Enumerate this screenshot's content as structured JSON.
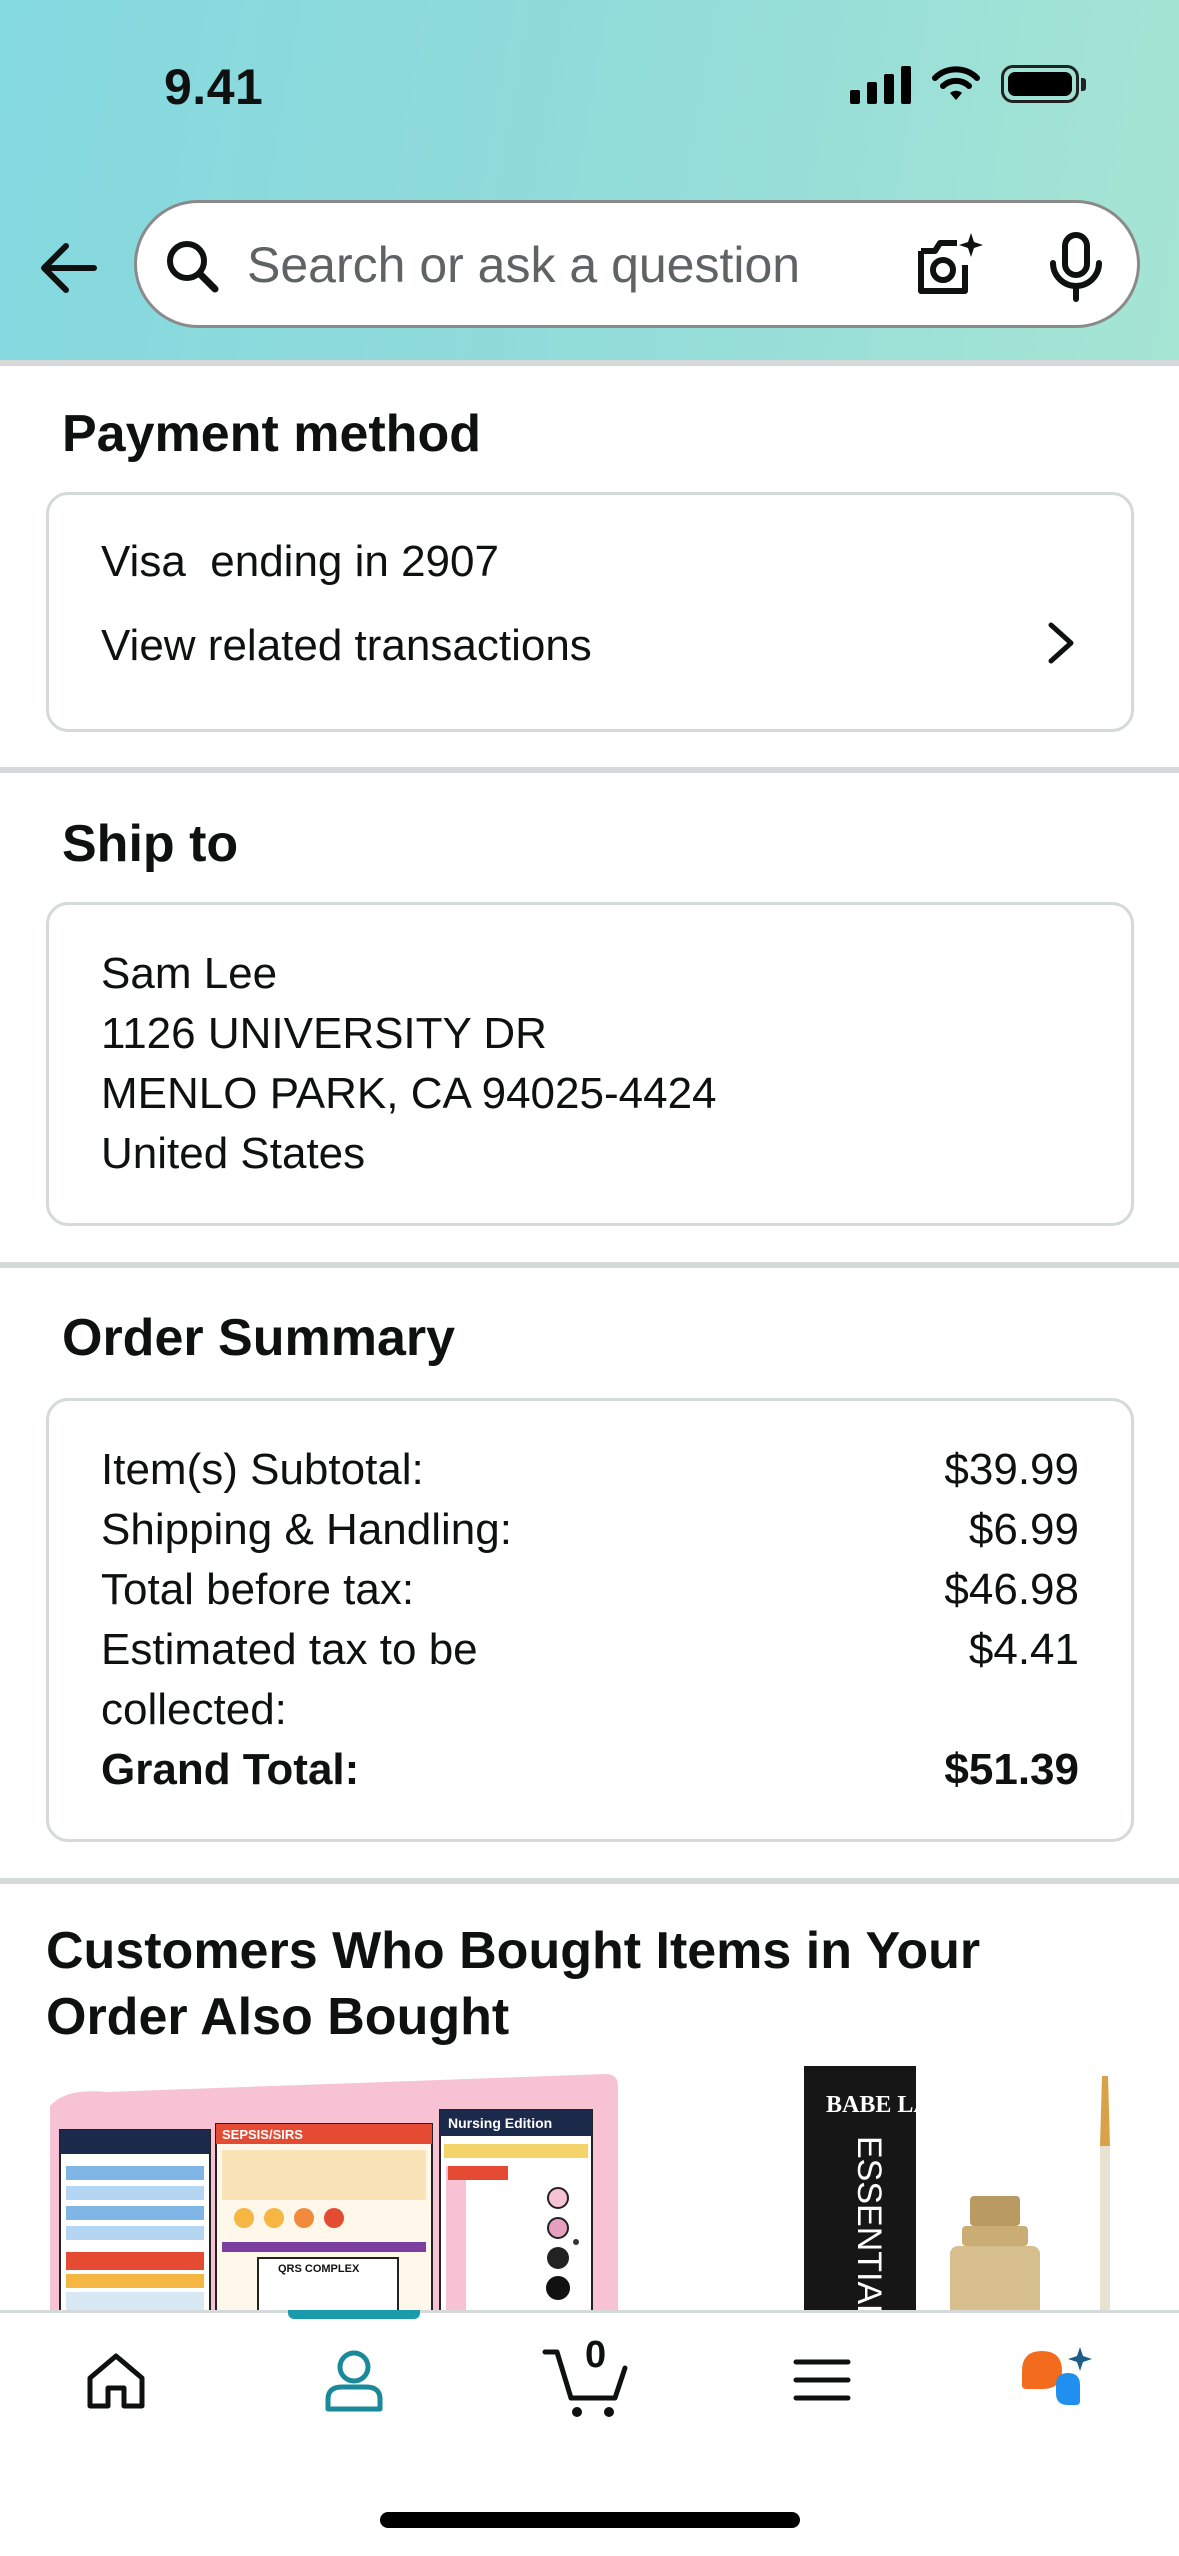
{
  "status_bar": {
    "time": "9.41",
    "icons": [
      "signal-icon",
      "wifi-icon",
      "battery-icon"
    ]
  },
  "header": {
    "back_icon": "back-arrow-icon",
    "search": {
      "placeholder": "Search or ask a question",
      "value": ""
    },
    "camera_icon": "camera-sparkle-icon",
    "mic_icon": "microphone-icon"
  },
  "payment": {
    "title": "Payment method",
    "card_brand": "Visa",
    "card_text": "ending in 2907",
    "link_label": "View related transactions"
  },
  "ship_to": {
    "title": "Ship to",
    "name": "Sam Lee",
    "street": "1126 UNIVERSITY DR",
    "city_line": "MENLO PARK, CA 94025-4424",
    "country": "United States"
  },
  "order_summary": {
    "title": "Order Summary",
    "rows": [
      {
        "label": "Item(s) Subtotal:",
        "value": "$39.99"
      },
      {
        "label": "Shipping & Handling:",
        "value": "$6.99"
      },
      {
        "label": "Total before tax:",
        "value": "$46.98"
      },
      {
        "label": "Estimated tax to be",
        "label_cont": "collected:",
        "value": "$4.41"
      },
      {
        "label": "Grand Total:",
        "value": "$51.39"
      }
    ]
  },
  "recommendations": {
    "title": "Customers Who Bought Items in Your Order Also Bought",
    "products": [
      {
        "image_label": "Nursing Edition",
        "image_text_2": "SEPSIS/SIRS",
        "image_text_3": "QRS COMPLEX"
      },
      {
        "image_label": "BABE LASH",
        "image_text_2": "ESSENTIAL L"
      }
    ]
  },
  "bottom_nav": {
    "items": [
      "home-icon",
      "account-icon",
      "cart-icon",
      "menu-icon",
      "rufus-assistant-icon"
    ],
    "active": "account-icon",
    "cart_count": "0"
  },
  "colors": {
    "header_gradient_start": "#84d8e0",
    "header_gradient_end": "#a6e5d4",
    "active_nav": "#1a8a9a",
    "rufus_orange": "#f36b1c",
    "rufus_blue": "#1f8ff0",
    "divider": "#d5d9d9"
  }
}
